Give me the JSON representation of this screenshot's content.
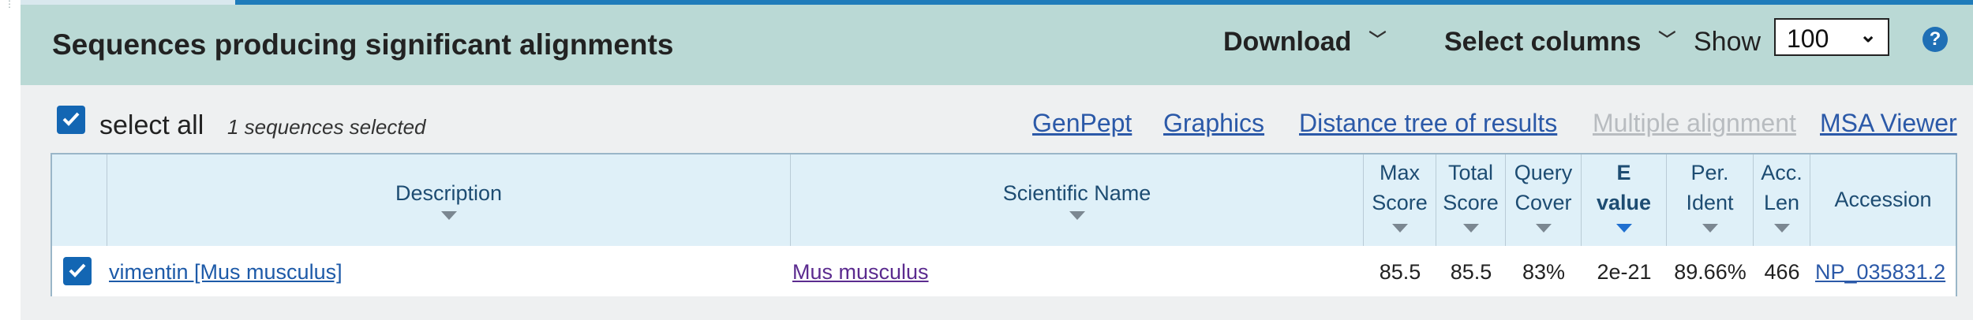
{
  "header": {
    "title": "Sequences producing significant alignments",
    "download_label": "Download",
    "select_columns_label": "Select columns",
    "show_label": "Show",
    "show_value": "100",
    "help_icon": "question-circle-icon"
  },
  "toolbar": {
    "select_all_label": "select all",
    "selected_count": "1 sequences selected",
    "links": {
      "genpept": "GenPept",
      "graphics": "Graphics",
      "distance_tree": "Distance tree of results",
      "multiple_alignment": "Multiple alignment",
      "msa_viewer": "MSA Viewer"
    }
  },
  "table": {
    "columns": {
      "description": "Description",
      "scientific_name": "Scientific Name",
      "max_score": [
        "Max",
        "Score"
      ],
      "total_score": [
        "Total",
        "Score"
      ],
      "query_cover": [
        "Query",
        "Cover"
      ],
      "e_value": [
        "E",
        "value"
      ],
      "per_ident": [
        "Per.",
        "Ident"
      ],
      "acc_len": [
        "Acc.",
        "Len"
      ],
      "accession": "Accession"
    },
    "rows": [
      {
        "description": "vimentin [Mus musculus]",
        "scientific_name": "Mus musculus",
        "max_score": "85.5",
        "total_score": "85.5",
        "query_cover": "83%",
        "e_value": "2e-21",
        "per_ident": "89.66%",
        "acc_len": "466",
        "accession": "NP_035831.2"
      }
    ]
  },
  "colors": {
    "header_bg": "#bad9d5",
    "accent_blue": "#1366b3",
    "link_blue": "#2b59a8",
    "visited_purple": "#5b2b8f"
  }
}
